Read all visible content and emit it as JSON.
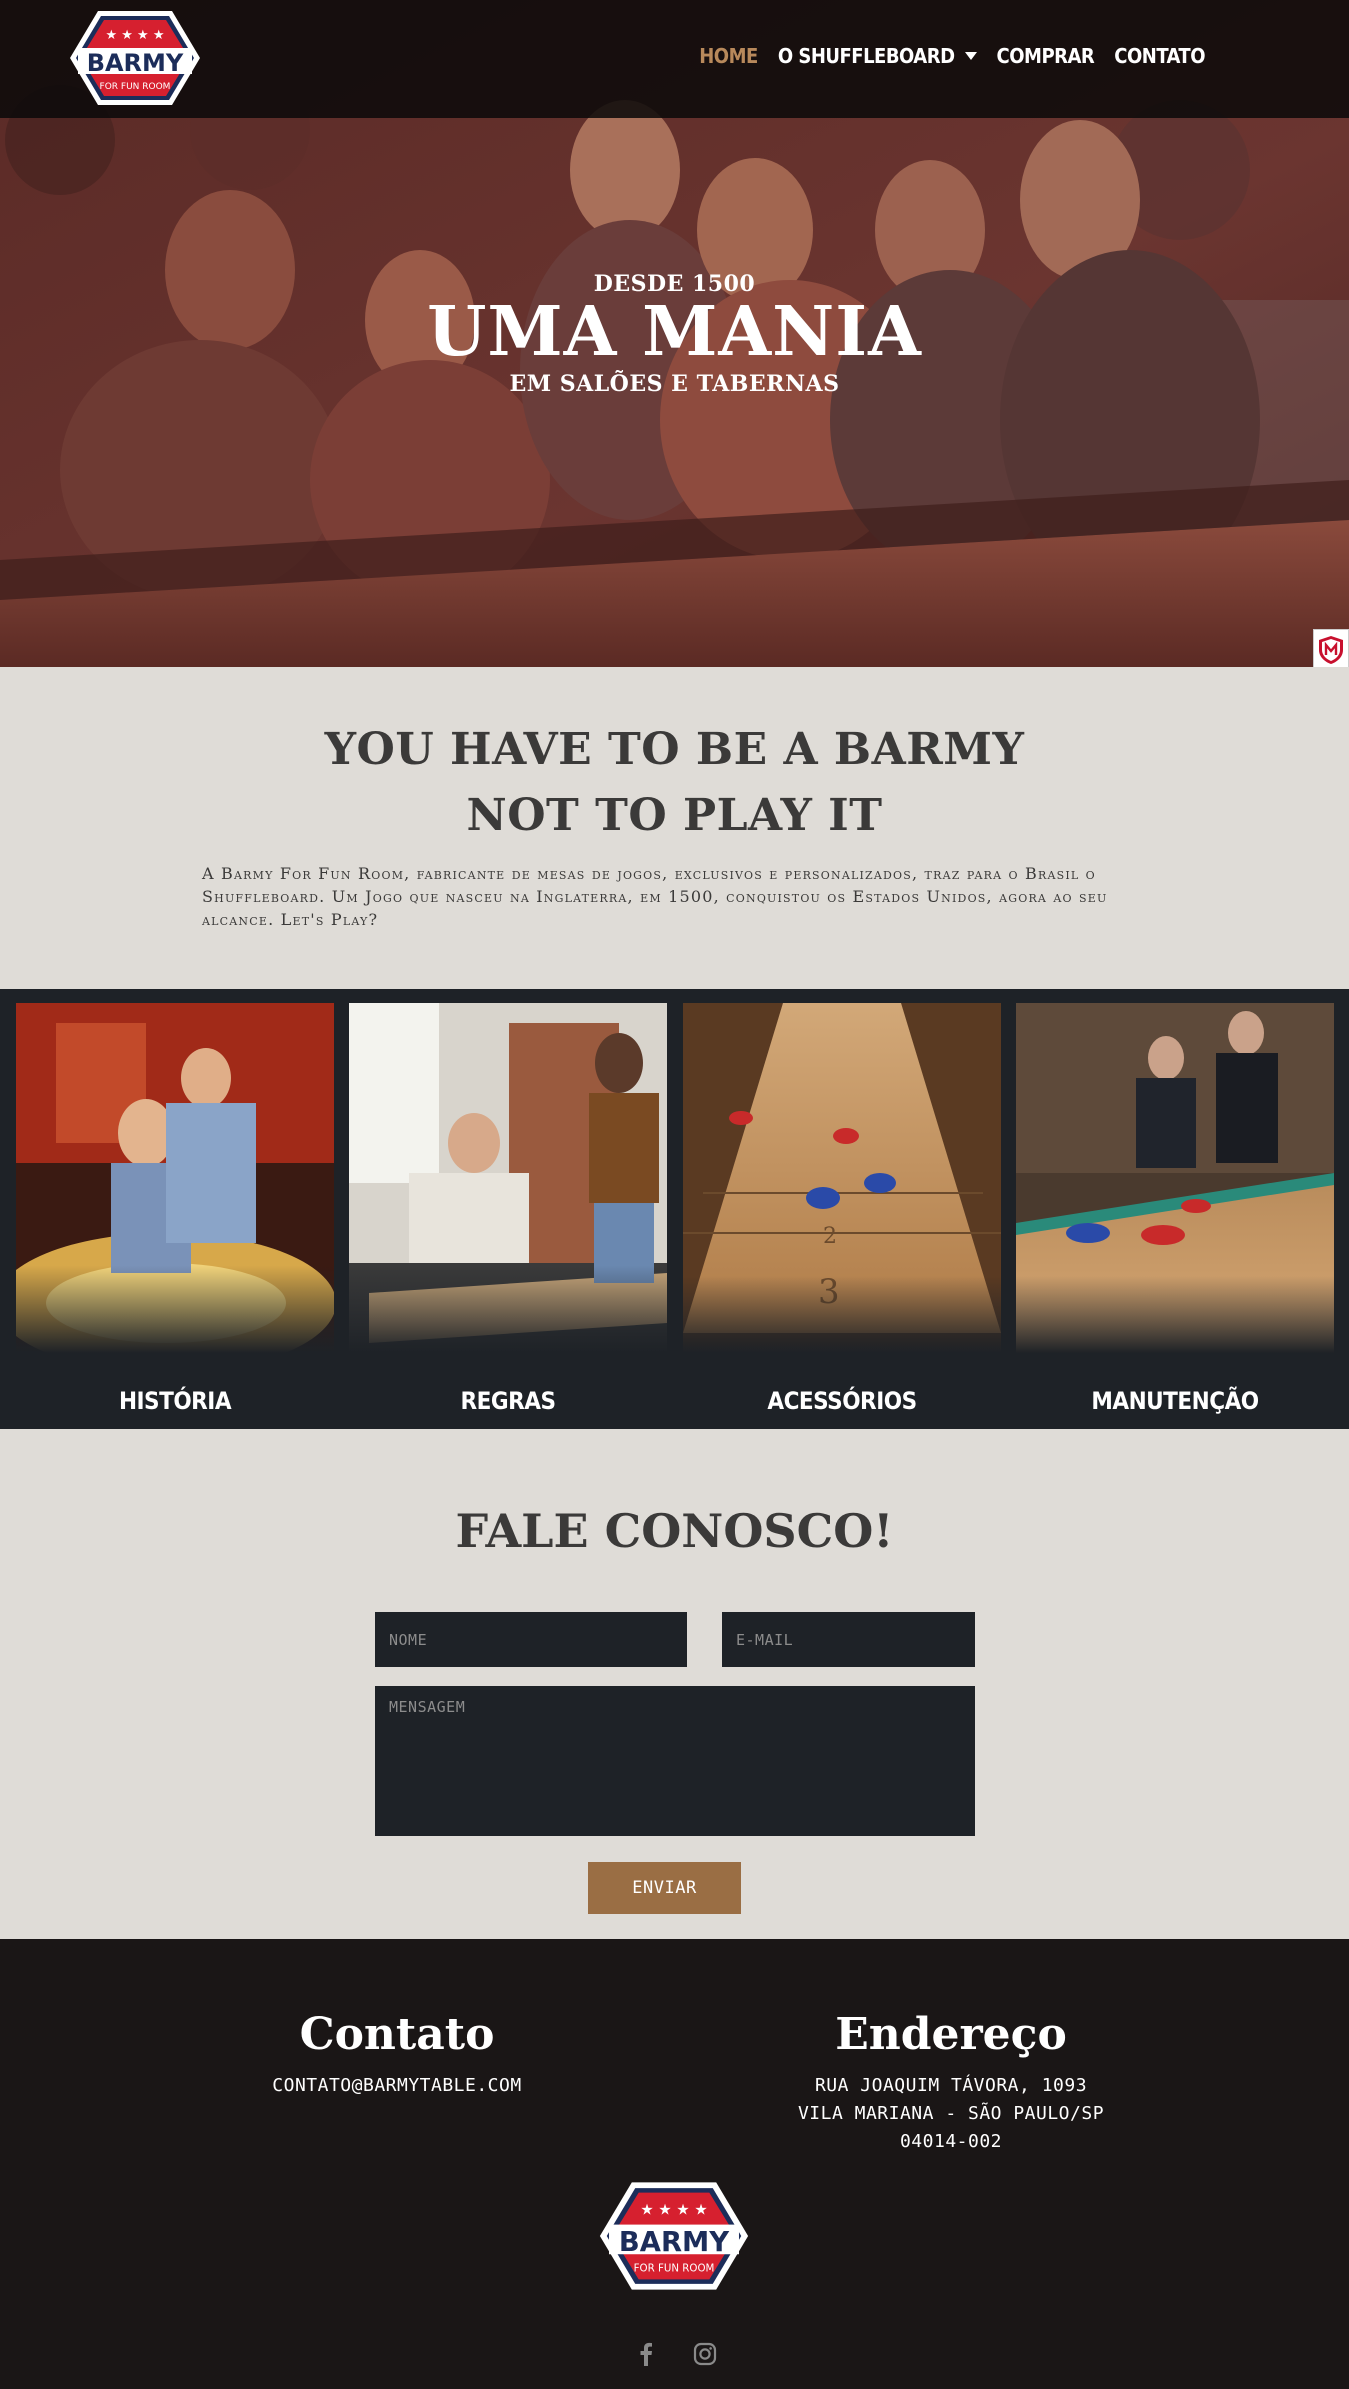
{
  "logo": {
    "brand": "BARMY",
    "tagline": "FOR FUN ROOM"
  },
  "nav": {
    "items": [
      {
        "label": "HOME",
        "active": true
      },
      {
        "label": "O SHUFFLEBOARD",
        "has_dropdown": true
      },
      {
        "label": "COMPRAR"
      },
      {
        "label": "CONTATO"
      }
    ]
  },
  "hero": {
    "since": "DESDE 1500",
    "title": "UMA MANIA",
    "subtitle": "EM SALÕES E TABERNAS"
  },
  "intro": {
    "title_line1": "YOU HAVE TO BE A BARMY",
    "title_line2": "NOT TO PLAY IT",
    "text": "A Barmy For Fun Room, fabricante de mesas de jogos, exclusivos e personalizados, traz para o Brasil o Shuffleboard. Um Jogo que nasceu na Inglaterra, em 1500, conquistou os Estados Unidos, agora ao seu alcance. Let's Play?"
  },
  "cards": [
    {
      "label": "HISTÓRIA"
    },
    {
      "label": "REGRAS"
    },
    {
      "label": "ACESSÓRIOS"
    },
    {
      "label": "MANUTENÇÃO"
    }
  ],
  "contact_form": {
    "title": "FALE CONOSCO!",
    "name_placeholder": "NOME",
    "email_placeholder": "E-MAIL",
    "message_placeholder": "MENSAGEM",
    "submit_label": "ENVIAR"
  },
  "footer": {
    "contact_heading": "Contato",
    "contact_email": "CONTATO@BARMYTABLE.COM",
    "address_heading": "Endereço",
    "address_line1": "RUA JOAQUIM TÁVORA, 1093",
    "address_line2": "VILA MARIANA - SÃO PAULO/SP",
    "address_line3": "04014-002",
    "social": [
      "facebook-icon",
      "instagram-icon"
    ]
  },
  "colors": {
    "accent": "#9a6e44",
    "nav_active": "#b8895b",
    "dark_panel": "#1e2227",
    "footer_bg": "#1a1616",
    "page_bg": "#dfdcd7",
    "logo_red": "#d6202f",
    "logo_navy": "#1c2d5a"
  }
}
